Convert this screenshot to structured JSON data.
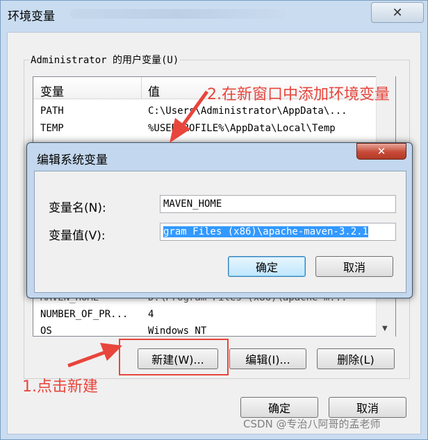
{
  "window": {
    "title": "环境变量",
    "close_symbol": "✕"
  },
  "user_vars": {
    "group_label": "Administrator 的用户变量(U)",
    "col_name": "变量",
    "col_value": "值",
    "rows": [
      {
        "name": "PATH",
        "value": "C:\\Users\\Administrator\\AppData\\..."
      },
      {
        "name": "TEMP",
        "value": "%USERPROFILE%\\AppData\\Local\\Temp"
      }
    ]
  },
  "system_vars": {
    "rows": [
      {
        "name": "MAVEN_HOME",
        "value": "D:\\Program Files (x86)\\apache-m..."
      },
      {
        "name": "NUMBER_OF_PR...",
        "value": "4"
      },
      {
        "name": "OS",
        "value": "Windows_NT"
      }
    ],
    "new_button": "新建(W)...",
    "edit_button": "编辑(I)...",
    "delete_button": "删除(L)"
  },
  "footer": {
    "ok_button": "确定",
    "cancel_button": "取消"
  },
  "dialog": {
    "title": "编辑系统变量",
    "close_symbol": "✕",
    "name_label": "变量名(N):",
    "name_value": "MAVEN_HOME",
    "value_label": "变量值(V):",
    "value_value": "gram Files (x86)\\apache-maven-3.2.1",
    "ok_button": "确定",
    "cancel_button": "取消"
  },
  "annotations": {
    "step1": "1.点击新建",
    "step2": "2.在新窗口中添加环境变量"
  },
  "watermark": "CSDN @专治八阿哥的孟老师",
  "colors": {
    "annotation_red": "#e8453c",
    "selection_blue": "#3399ff",
    "window_frame": "#c9dcf0"
  }
}
